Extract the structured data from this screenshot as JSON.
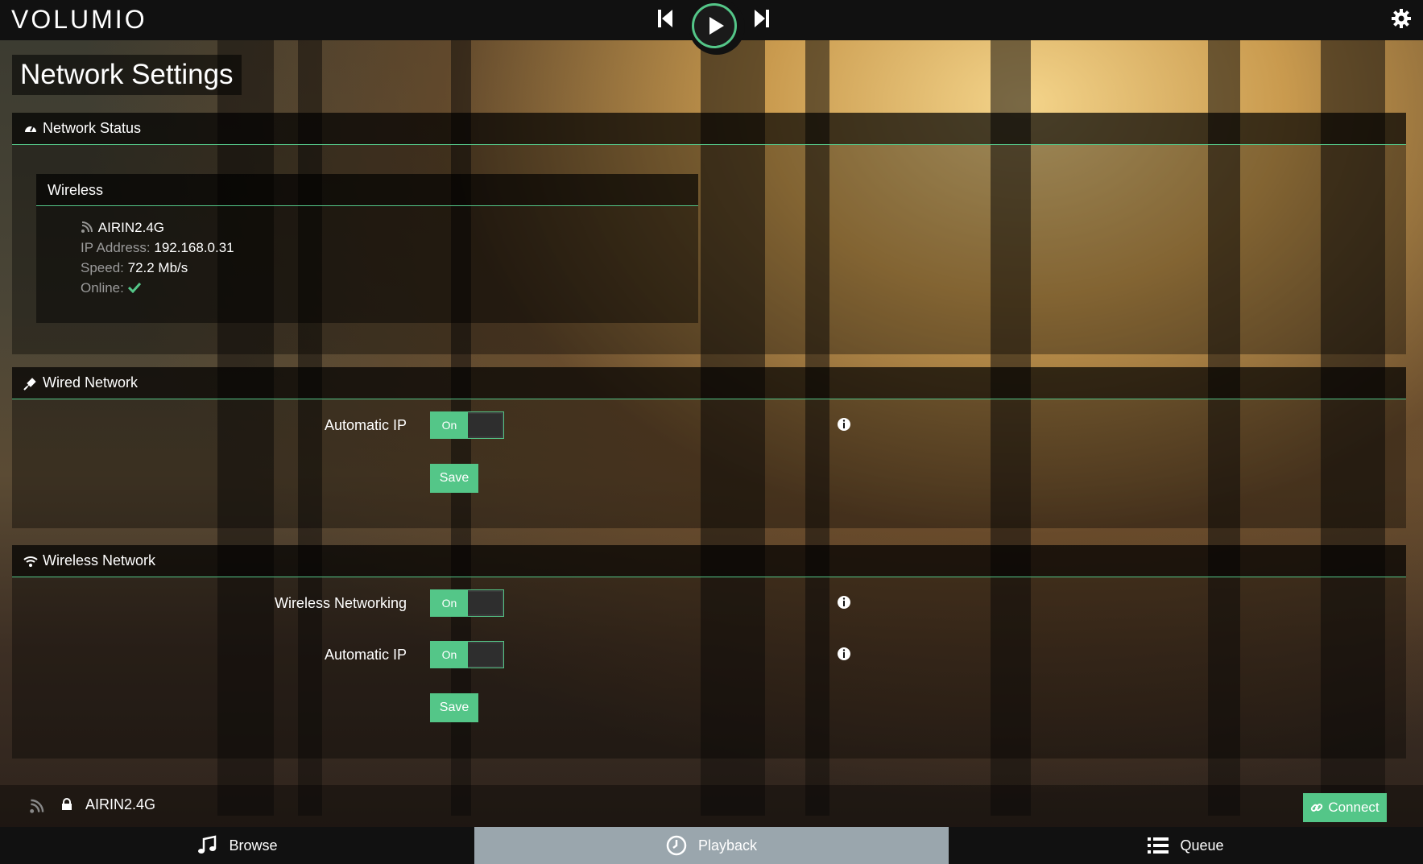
{
  "app": {
    "logo_text": "VOLUMIO"
  },
  "colors": {
    "accent": "#54c688",
    "topbar_bg": "#111111"
  },
  "transport": {
    "prev_icon": "skip-previous-icon",
    "play_icon": "play-icon",
    "next_icon": "skip-next-icon",
    "settings_icon": "gear-icon"
  },
  "page": {
    "title": "Network Settings"
  },
  "network_status": {
    "header": "Network Status",
    "icon": "dashboard-icon",
    "card_title": "Wireless",
    "ssid": "AIRIN2.4G",
    "ip_label": "IP Address:",
    "ip_value": "192.168.0.31",
    "speed_label": "Speed:",
    "speed_value": "72.2 Mb/s",
    "online_label": "Online:",
    "online_icon": "check-icon"
  },
  "wired": {
    "header": "Wired Network",
    "icon": "plug-icon",
    "auto_ip_label": "Automatic IP",
    "auto_ip_state": "On",
    "save_label": "Save"
  },
  "wireless": {
    "header": "Wireless Network",
    "icon": "wifi-icon",
    "networking_label": "Wireless Networking",
    "networking_state": "On",
    "auto_ip_label": "Automatic IP",
    "auto_ip_state": "On",
    "save_label": "Save"
  },
  "wifi_list": [
    {
      "ssid": "AIRIN2.4G",
      "signal_icon": "signal-icon",
      "lock_icon": "lock-icon",
      "connect_label": "Connect"
    }
  ],
  "bottom_nav": {
    "browse": "Browse",
    "playback": "Playback",
    "queue": "Queue",
    "active": "Playback"
  }
}
